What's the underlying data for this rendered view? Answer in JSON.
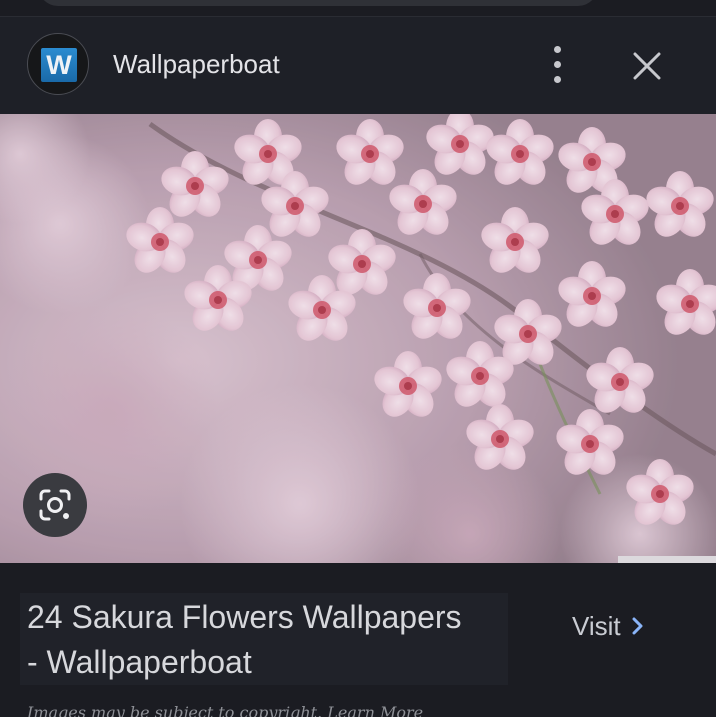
{
  "header": {
    "site_name": "Wallpaperboat",
    "logo_letter": "W"
  },
  "hero": {
    "image_subject": "pink sakura cherry blossoms"
  },
  "result": {
    "title_line1": "24 Sakura Flowers Wallpapers",
    "title_line2": "- Wallpaperboat",
    "visit_label": "Visit",
    "copyright_text": "Images may be subject to copyright.",
    "learn_more_label": "Learn More"
  },
  "colors": {
    "background": "#1b1c22",
    "accent_blue": "#8ab4f8",
    "logo_blue": "#2b8cd0"
  }
}
